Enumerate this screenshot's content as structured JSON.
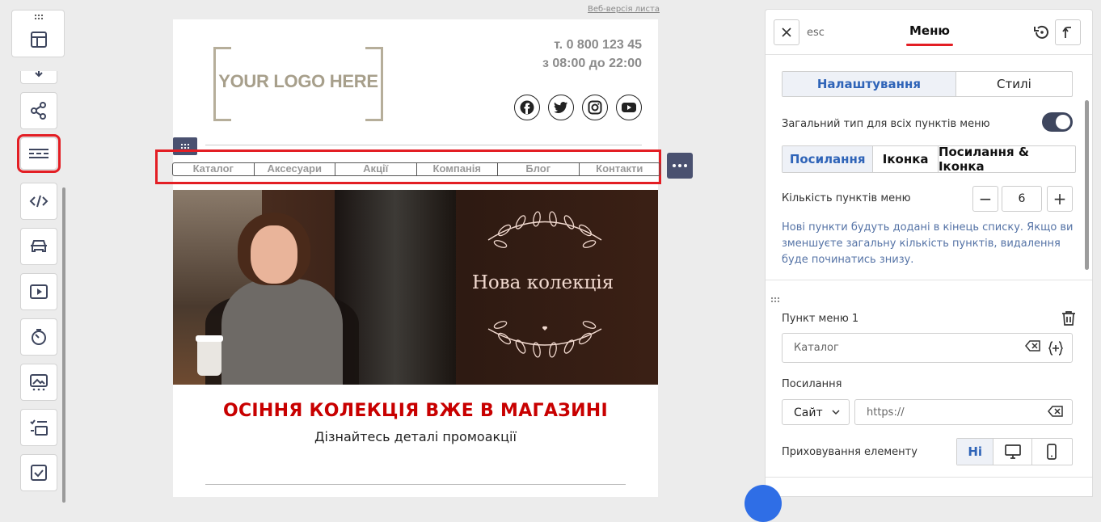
{
  "left_toolbar": {
    "tools": [
      {
        "name": "download-icon"
      },
      {
        "name": "share-icon"
      },
      {
        "name": "menu-block-icon",
        "active": true
      },
      {
        "name": "code-icon"
      },
      {
        "name": "car-icon"
      },
      {
        "name": "video-icon"
      },
      {
        "name": "timer-icon"
      },
      {
        "name": "image-banner-icon"
      },
      {
        "name": "list-blocks-icon"
      },
      {
        "name": "checkbox-icon"
      }
    ]
  },
  "email": {
    "web_version_link": "Веб-версія листа",
    "logo_text": "YOUR LOGO HERE",
    "phone": "т. 0 800 123 45",
    "hours": "з 08:00 до 22:00",
    "socials": [
      "facebook-icon",
      "twitter-icon",
      "instagram-icon",
      "youtube-icon"
    ],
    "menu_items": [
      "Каталог",
      "Аксесуари",
      "Акції",
      "Компанія",
      "Блог",
      "Контакти"
    ],
    "banner_title": "Нова колекція",
    "promo_title": "ОСІННЯ КОЛЕКЦІЯ ВЖЕ В МАГАЗИНІ",
    "promo_subtitle": "Дізнайтесь деталі промоакції"
  },
  "panel": {
    "esc_label": "esc",
    "title": "Меню",
    "tabs": [
      "Налаштування",
      "Стилі"
    ],
    "active_tab": "Налаштування",
    "common_type_label": "Загальний тип для всіх пунктів меню",
    "common_type_enabled": true,
    "type_options": [
      "Посилання",
      "Іконка",
      "Посилання & Іконка"
    ],
    "active_type": "Посилання",
    "count_label": "Кількість пунктів меню",
    "count_value": "6",
    "count_minus": "−",
    "count_plus": "+",
    "help_text": "Нові пункти будуть додані в кінець списку. Якщо ви зменшуєте загальну кількість пунктів, видалення буде починатись знизу.",
    "item1_label": "Пункт меню 1",
    "item1_value": "Каталог",
    "link_label": "Посилання",
    "link_type": "Сайт",
    "link_placeholder": "https://",
    "hide_label": "Приховування елементу",
    "hide_options": [
      "Ні"
    ],
    "hide_selected": "Ні"
  },
  "colors": {
    "accent_red": "#e31e24",
    "panel_blue": "#2f64b8",
    "handle_dark": "#4a5170",
    "promo_red": "#c80000"
  }
}
